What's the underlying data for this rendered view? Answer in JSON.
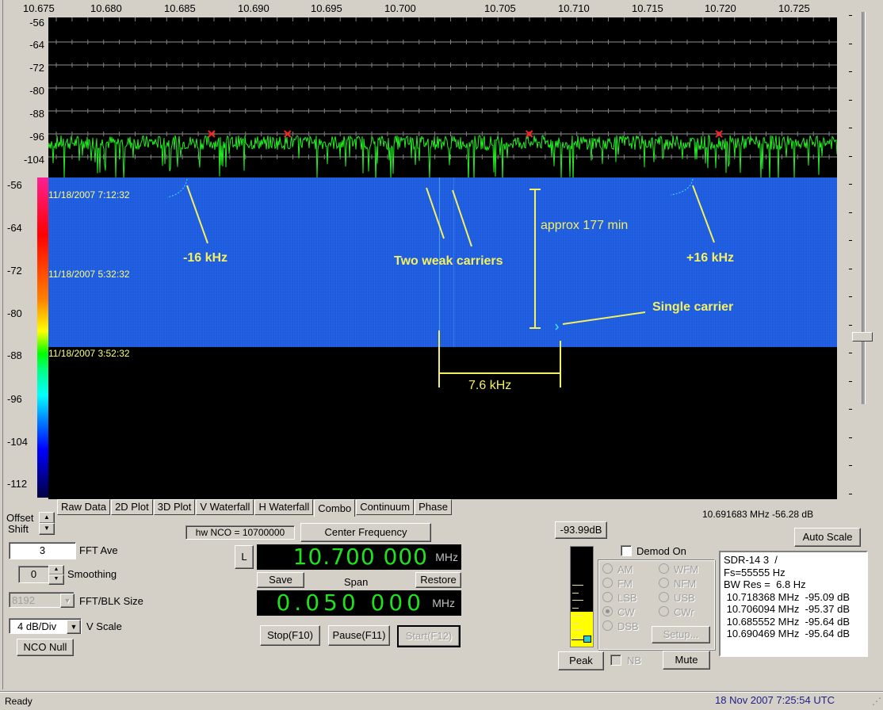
{
  "spectrum": {
    "freq_ticks": [
      "10.675",
      "10.680",
      "10.685",
      "10.690",
      "10.695",
      "10.700",
      "10.705",
      "10.710",
      "10.715",
      "10.720",
      "10.725"
    ],
    "db_ticks": [
      "-56",
      "-64",
      "-72",
      "-80",
      "-88",
      "-96",
      "-104"
    ],
    "trace_color": "#22ee22",
    "noise_floor_db": -99,
    "peak_markers_mhz": [
      10.685552,
      10.690469,
      10.706094,
      10.718368
    ]
  },
  "waterfall": {
    "colorbar_ticks": [
      "-56",
      "-64",
      "-72",
      "-80",
      "-88",
      "-96",
      "-104",
      "-112"
    ],
    "timestamps": [
      "11/18/2007 7:12:32",
      "11/18/2007 5:32:32",
      "11/18/2007 3:52:32"
    ],
    "annotations": {
      "minus16": "-16 kHz",
      "two_weak": "Two weak carriers",
      "approx": "approx 177 min",
      "plus16": "+16 kHz",
      "single": "Single carrier",
      "span76": "7.6 kHz"
    }
  },
  "tabs": [
    "Raw Data",
    "2D Plot",
    "3D Plot",
    "V Waterfall",
    "H Waterfall",
    "Combo",
    "Continuum",
    "Phase"
  ],
  "active_tab": "Combo",
  "controls": {
    "offset_label": "Offset",
    "shift_label": "Shift",
    "fft_ave_value": "3",
    "fft_ave_label": "FFT Ave",
    "smoothing_value": "0",
    "smoothing_label": "Smoothing",
    "fft_blk_value": "8192",
    "fft_blk_label": "FFT/BLK Size",
    "vscale_value": "4 dB/Div",
    "vscale_label": "V Scale",
    "nco_null": "NCO Null"
  },
  "tuning": {
    "hw_nco": "hw NCO = 10700000",
    "center_freq_btn": "Center Frequency",
    "l_btn": "L",
    "center_value": "10.700 000",
    "center_unit": "MHz",
    "save": "Save",
    "span_label": "Span",
    "restore": "Restore",
    "span_value": "0.050 000",
    "span_unit": "MHz",
    "stop": "Stop(F10)",
    "pause": "Pause(F11)",
    "start": "Start(F12)"
  },
  "demod": {
    "level_btn": "-93.99dB",
    "meter_level_fraction": 0.35,
    "demod_on": "Demod On",
    "modes_left": [
      "AM",
      "FM",
      "LSB",
      "CW",
      "DSB"
    ],
    "modes_right": [
      "WFM",
      "NFM",
      "USB",
      "CWr"
    ],
    "selected_mode": "CW",
    "setup": "Setup...",
    "peak": "Peak",
    "nb": "NB",
    "mute": "Mute"
  },
  "readout": {
    "cursor": "10.691683 MHz  -56.28 dB",
    "auto_scale": "Auto Scale",
    "info_lines": [
      "SDR-14 3  /",
      "Fs=55555 Hz",
      "BW Res =  6.8 Hz",
      " 10.718368 MHz  -95.09 dB",
      " 10.706094 MHz  -95.37 dB",
      " 10.685552 MHz  -95.64 dB",
      " 10.690469 MHz  -95.64 dB"
    ]
  },
  "status": {
    "left": "Ready",
    "right": "18 Nov 2007  7:25:54 UTC"
  }
}
